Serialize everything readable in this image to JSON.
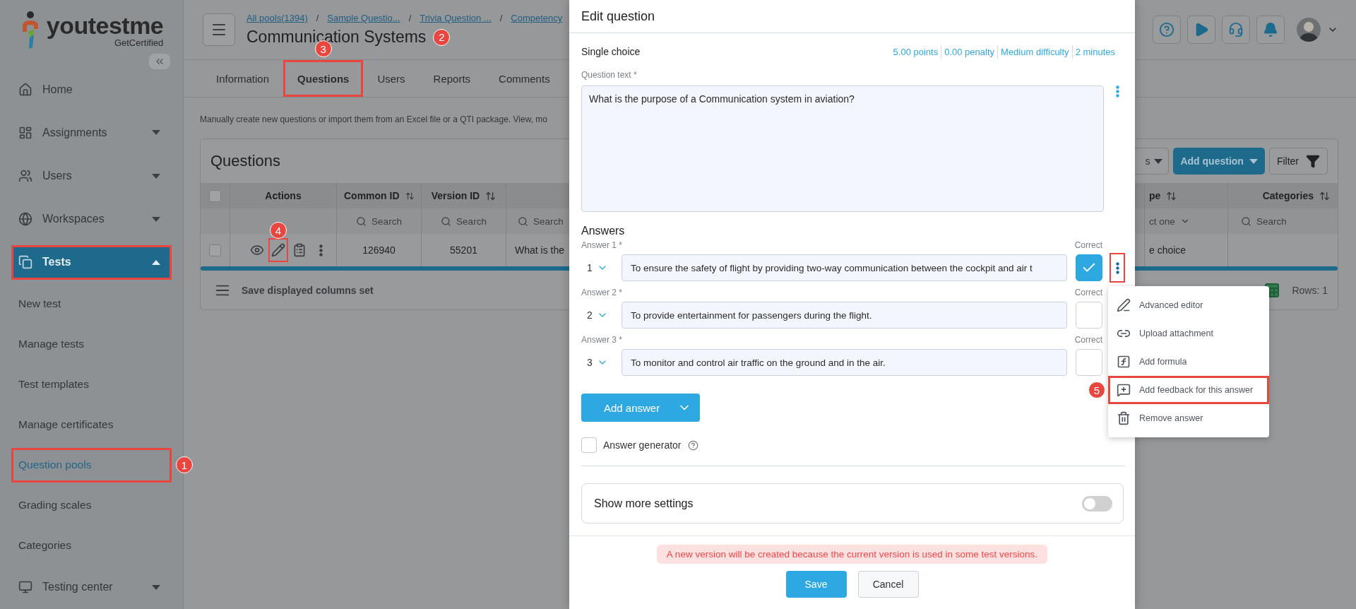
{
  "sidebar": {
    "logo": {
      "name": "youtestme",
      "tagline": "GetCertified"
    },
    "items": [
      {
        "label": "Home",
        "selected": false
      },
      {
        "label": "Assignments",
        "selected": false,
        "expanded": false
      },
      {
        "label": "Users",
        "selected": false,
        "expanded": false
      },
      {
        "label": "Workspaces",
        "selected": false,
        "expanded": false
      },
      {
        "label": "Tests",
        "selected": true,
        "expanded": true,
        "highlighted": true,
        "children": [
          {
            "label": "New test",
            "selected": false
          },
          {
            "label": "Manage tests",
            "selected": false
          },
          {
            "label": "Test templates",
            "selected": false
          },
          {
            "label": "Manage certificates",
            "selected": false
          },
          {
            "label": "Question pools",
            "selected": true,
            "highlighted": true,
            "marker": "1"
          },
          {
            "label": "Grading scales",
            "selected": false
          },
          {
            "label": "Categories",
            "selected": false
          }
        ]
      },
      {
        "label": "Testing center",
        "selected": false,
        "expanded": false
      }
    ]
  },
  "header": {
    "breadcrumbs": [
      {
        "label": "All pools(1394)",
        "separator": "/"
      },
      {
        "label": "Sample Questio...",
        "separator": "/"
      },
      {
        "label": "Trivia Question ...",
        "separator": "/"
      },
      {
        "label": "Competency"
      }
    ],
    "title": "Communication Systems",
    "title_marker": "2"
  },
  "tabs": [
    {
      "label": "Information",
      "selected": false
    },
    {
      "label": "Questions",
      "selected": true,
      "highlighted": true,
      "marker": "3"
    },
    {
      "label": "Users",
      "selected": false
    },
    {
      "label": "Reports",
      "selected": false
    },
    {
      "label": "Comments",
      "selected": false
    }
  ],
  "description": "Manually create new questions or import them from an Excel file or a QTI package. View, mo",
  "questions": {
    "title": "Questions",
    "toolbar": [
      {
        "label": "s",
        "kind": "dropdown"
      },
      {
        "label": "Add question",
        "kind": "primary"
      },
      {
        "label": "Filter",
        "kind": "filter"
      }
    ],
    "header_checked": false,
    "actions_header": "Actions",
    "columns": [
      {
        "label": "Common ID",
        "sortable": true,
        "filter": {
          "kind": "search",
          "text": "Search"
        }
      },
      {
        "label": "Version ID",
        "sortable": true,
        "filter": {
          "kind": "search",
          "text": "Search"
        }
      },
      {
        "filter": {
          "kind": "search",
          "text": "Search"
        }
      },
      {
        "label": "pe",
        "sortable": true,
        "filter": {
          "kind": "select",
          "text": "ct one"
        }
      },
      {
        "label": "Categories",
        "sortable": true,
        "filter": {
          "kind": "search",
          "text": "Search"
        }
      }
    ],
    "rows": [
      {
        "checked": false,
        "actions": [
          {
            "highlighted": false
          },
          {
            "highlighted": true,
            "marker": "4"
          },
          {
            "highlighted": false
          },
          {
            "highlighted": false
          }
        ],
        "cells": [
          "126940",
          "55201",
          "What is the",
          "e choice"
        ]
      }
    ],
    "footer": {
      "save_label": "Save displayed columns set",
      "rows_count": "Rows: 1"
    }
  },
  "dialog": {
    "title": "Edit question",
    "question_type": "Single choice",
    "stats": [
      "5.00 points",
      "0.00 penalty",
      "Medium difficulty",
      "2 minutes"
    ],
    "question_label": "Question text *",
    "question_text": "What is the purpose of a Communication system in aviation?",
    "answers_heading": "Answers",
    "answers": [
      {
        "label": "Answer 1 *",
        "correct_label": "Correct",
        "number": "1",
        "text": "To ensure the safety of flight by providing two-way communication between the cockpit and air t",
        "correct": true,
        "menu_button": {
          "highlighted": true
        }
      },
      {
        "label": "Answer 2 *",
        "correct_label": "Correct",
        "number": "2",
        "text": "To provide entertainment for passengers during the flight.",
        "correct": false
      },
      {
        "label": "Answer 3 *",
        "correct_label": "Correct",
        "number": "3",
        "text": "To monitor and control air traffic on the ground and in the air.",
        "correct": false
      }
    ],
    "add_answer": "Add answer",
    "generator": {
      "label": "Answer generator",
      "checked": false
    },
    "more_settings": {
      "label": "Show more settings",
      "on": false
    },
    "warning": "A new version will be created because the current version is used in some test versions.",
    "buttons": [
      {
        "label": "Save",
        "kind": "primary"
      },
      {
        "label": "Cancel",
        "kind": "secondary"
      }
    ]
  },
  "answer_menu": [
    {
      "label": "Advanced editor",
      "highlighted": false
    },
    {
      "label": "Upload attachment",
      "highlighted": false
    },
    {
      "label": "Add formula",
      "highlighted": false
    },
    {
      "label": "Add feedback for this answer",
      "highlighted": true,
      "marker": "5"
    },
    {
      "label": "Remove answer",
      "highlighted": false
    }
  ]
}
